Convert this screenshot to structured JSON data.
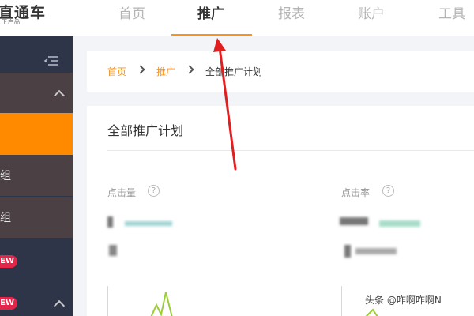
{
  "app": {
    "logo_main": "直通车",
    "logo_sub": "下产品"
  },
  "nav": {
    "items": [
      {
        "label": "首页"
      },
      {
        "label": "推广"
      },
      {
        "label": "报表"
      },
      {
        "label": "账户"
      },
      {
        "label": "工具"
      }
    ],
    "active_index": 1
  },
  "sidebar": {
    "items": [
      {
        "label": "组"
      },
      {
        "label": "组"
      }
    ],
    "new_badge": "EW"
  },
  "breadcrumb": {
    "items": [
      "首页",
      "推广",
      "全部推广计划"
    ]
  },
  "card": {
    "title": "全部推广计划",
    "metrics": [
      {
        "label": "点击量",
        "help": "?"
      },
      {
        "label": "点击率",
        "help": "?"
      }
    ]
  },
  "watermark": "头条 @咋啊咋啊N",
  "colors": {
    "accent": "#f7931e",
    "sidebar": "#2e3549",
    "sidebar_group": "#4b4145",
    "sidebar_active": "#ff8a00",
    "badge": "#e4254a",
    "arrow": "#e02020",
    "chart_line": "#9ccc3a"
  }
}
